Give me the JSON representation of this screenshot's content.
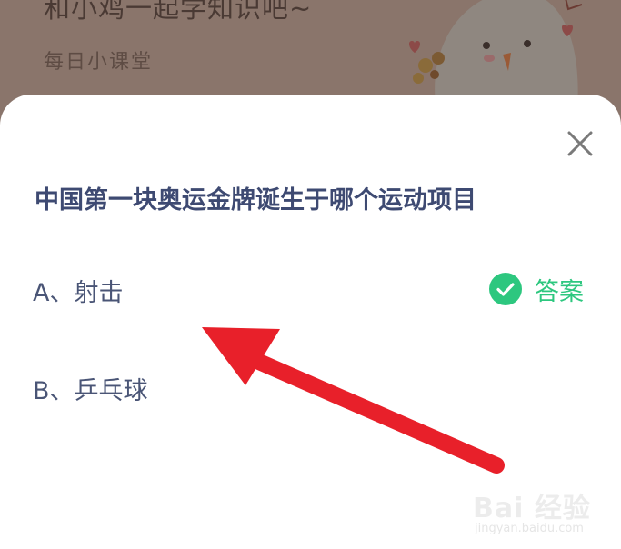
{
  "background": {
    "title": "和小鸡一起学知识吧~",
    "subtitle": "每日小课堂"
  },
  "sheet": {
    "question": "中国第一块奥运金牌诞生于哪个运动项目",
    "options": [
      {
        "label": "A、射击",
        "is_answer": true
      },
      {
        "label": "B、乒乓球",
        "is_answer": false
      }
    ],
    "answer_label": "答案"
  },
  "watermark": {
    "logo": "Bai 经验",
    "url": "jingyan.baidu.com"
  },
  "colors": {
    "question_text": "#3e4a72",
    "option_text": "#4a5576",
    "answer_green": "#2dc77f",
    "arrow_red": "#e8202a"
  }
}
